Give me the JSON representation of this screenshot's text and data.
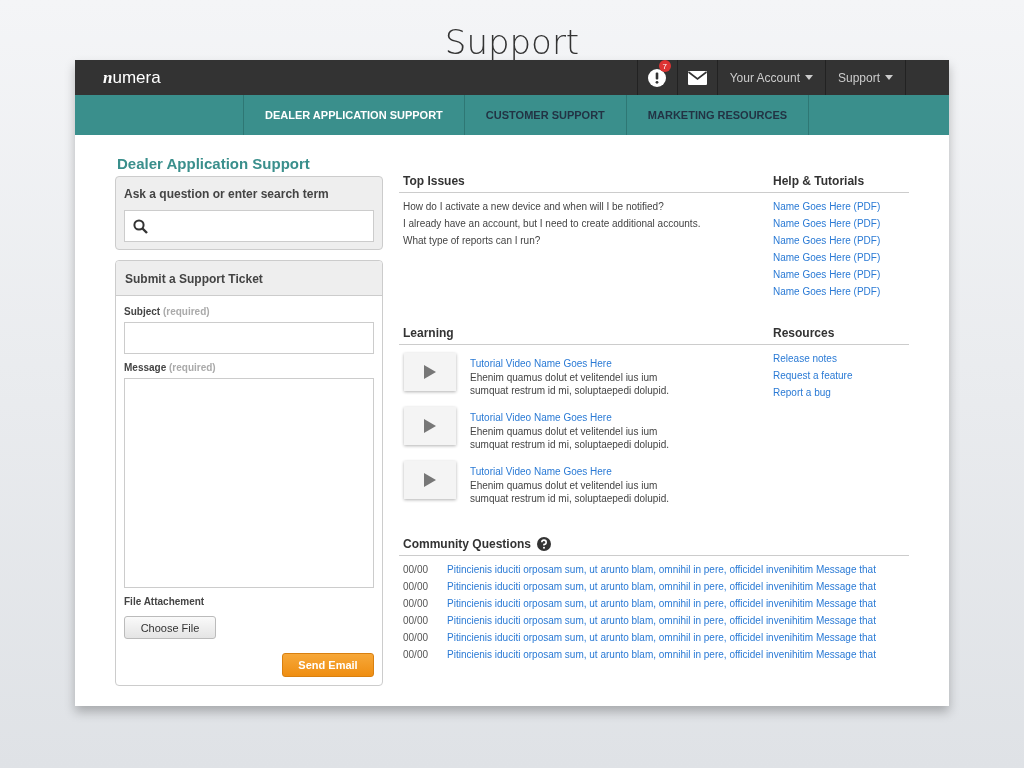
{
  "slide_title": "Support",
  "top_bar": {
    "logo": "numera",
    "alert_count": "7",
    "menus": [
      "Your Account",
      "Support"
    ]
  },
  "nav_tabs": [
    {
      "label": "DEALER APPLICATION SUPPORT",
      "selected": true
    },
    {
      "label": "CUSTOMER SUPPORT",
      "selected": false
    },
    {
      "label": "MARKETING RESOURCES",
      "selected": false
    }
  ],
  "page_title": "Dealer Application Support",
  "search": {
    "label": "Ask a question or enter search term"
  },
  "ticket": {
    "title": "Submit a Support Ticket",
    "fields": [
      {
        "label": "Subject",
        "hint": "(required)",
        "kind": "line"
      },
      {
        "label": "Message",
        "hint": "(required)",
        "kind": "area"
      }
    ],
    "attachment_label": "File Attachement",
    "choose_button": "Choose File",
    "send_button": "Send Email"
  },
  "top_issues": {
    "title": "Top Issues",
    "items": [
      "How do I activate a new device and when will I be notified?",
      "I already have an account, but I need to create additional accounts.",
      "What type of reports can I run?"
    ]
  },
  "help": {
    "title": "Help & Tutorials",
    "links": [
      "Name Goes Here (PDF)",
      "Name Goes Here (PDF)",
      "Name Goes Here (PDF)",
      "Name Goes Here (PDF)",
      "Name Goes Here (PDF)",
      "Name Goes Here (PDF)"
    ]
  },
  "learning": {
    "title": "Learning",
    "videos": [
      {
        "title": "Tutorial Video Name Goes Here",
        "description": "Ehenim quamus dolut et velitendel ius ium sumquat restrum id mi, soluptaepedi dolupid."
      },
      {
        "title": "Tutorial Video Name Goes Here",
        "description": "Ehenim quamus dolut et velitendel ius ium sumquat restrum id mi, soluptaepedi dolupid."
      },
      {
        "title": "Tutorial Video Name Goes Here",
        "description": "Ehenim quamus dolut et velitendel ius ium sumquat restrum id mi, soluptaepedi dolupid."
      }
    ]
  },
  "resources": {
    "title": "Resources",
    "links": [
      "Release notes",
      "Request a feature",
      "Report a bug"
    ]
  },
  "community": {
    "title": "Community Questions",
    "rows": [
      {
        "date": "00/00",
        "text": "Pitincienis iduciti orposam sum, ut arunto blam, omnihil in pere, officidel invenihitim Message that"
      },
      {
        "date": "00/00",
        "text": "Pitincienis iduciti orposam sum, ut arunto blam, omnihil in pere, officidel invenihitim Message that"
      },
      {
        "date": "00/00",
        "text": "Pitincienis iduciti orposam sum, ut arunto blam, omnihil in pere, officidel invenihitim Message that"
      },
      {
        "date": "00/00",
        "text": "Pitincienis iduciti orposam sum, ut arunto blam, omnihil in pere, officidel invenihitim Message that"
      },
      {
        "date": "00/00",
        "text": "Pitincienis iduciti orposam sum, ut arunto blam, omnihil in pere, officidel invenihitim Message that"
      },
      {
        "date": "00/00",
        "text": "Pitincienis iduciti orposam sum, ut arunto blam, omnihil in pere, officidel invenihitim Message that"
      }
    ]
  }
}
